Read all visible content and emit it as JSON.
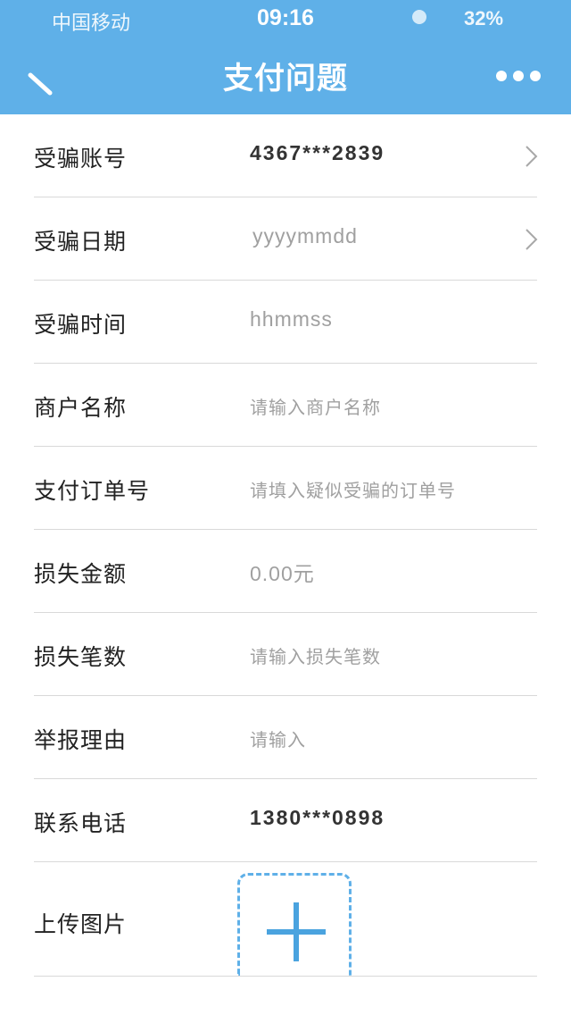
{
  "status_bar": {
    "carrier": "中国移动",
    "time": "09:16",
    "battery": "32%"
  },
  "nav": {
    "title": "支付问题"
  },
  "icons": {
    "back": "back-arrow-icon",
    "more": "more-dots-icon",
    "chevron": "chevron-right-icon",
    "plus": "plus-icon"
  },
  "colors": {
    "header": "#5fb0e8",
    "accent": "#4aa3df",
    "divider": "#d9d9d9",
    "placeholder": "#a0a0a0"
  },
  "form": {
    "rows": [
      {
        "label": "受骗账号",
        "value": "4367***2839"
      },
      {
        "label": "受骗日期",
        "value": "yyyymmdd"
      },
      {
        "label": "受骗时间",
        "value": "hhmmss"
      },
      {
        "label": "商户名称",
        "placeholder": "请输入商户名称"
      },
      {
        "label": "支付订单号",
        "placeholder": "请填入疑似受骗的订单号"
      },
      {
        "label": "损失金额",
        "value": "0.00元"
      },
      {
        "label": "损失笔数",
        "placeholder": "请输入损失笔数"
      },
      {
        "label": "举报理由",
        "placeholder": "请输入"
      },
      {
        "label": "联系电话",
        "value": "1380***0898"
      },
      {
        "label": "上传图片"
      }
    ]
  }
}
